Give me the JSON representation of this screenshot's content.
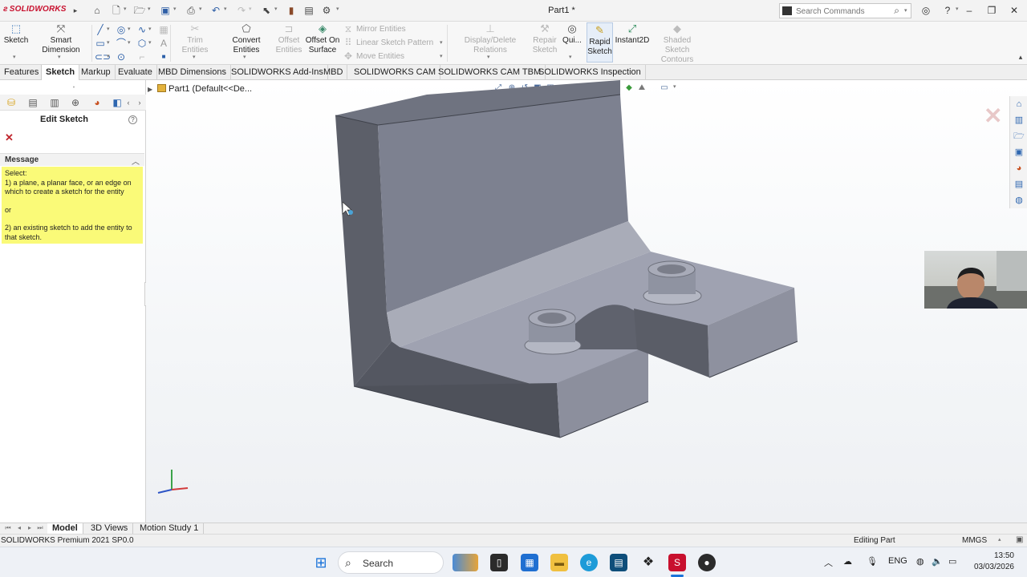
{
  "app": {
    "logo_text": "SOLIDWORKS",
    "document_title": "Part1 *",
    "brand_color": "#c8102e"
  },
  "search": {
    "placeholder": "Search Commands"
  },
  "ribbon": {
    "sketch_label": "Sketch",
    "smart_dimension_label": "Smart Dimension",
    "trim_entities_label": "Trim Entities",
    "convert_entities_label": "Convert Entities",
    "offset_entities_label_1": "Offset",
    "offset_entities_label_2": "Entities",
    "offset_on_surface_label_1": "Offset On",
    "offset_on_surface_label_2": "Surface",
    "mirror_entities_label": "Mirror Entities",
    "linear_sketch_pattern_label": "Linear Sketch Pattern",
    "move_entities_label": "Move Entities",
    "display_delete_relations_label": "Display/Delete Relations",
    "repair_sketch_label_1": "Repair",
    "repair_sketch_label_2": "Sketch",
    "quick_snaps_label": "Qui...",
    "rapid_sketch_label_1": "Rapid",
    "rapid_sketch_label_2": "Sketch",
    "instant2d_label": "Instant2D",
    "shaded_sketch_contours_label_1": "Shaded Sketch",
    "shaded_sketch_contours_label_2": "Contours"
  },
  "tabs": [
    {
      "label": "Features"
    },
    {
      "label": "Sketch"
    },
    {
      "label": "Markup"
    },
    {
      "label": "Evaluate"
    },
    {
      "label": "MBD Dimensions"
    },
    {
      "label": "SOLIDWORKS Add-Ins"
    },
    {
      "label": "MBD"
    },
    {
      "label": "SOLIDWORKS CAM"
    },
    {
      "label": "SOLIDWORKS CAM TBM"
    },
    {
      "label": "SOLIDWORKS Inspection"
    }
  ],
  "property_manager": {
    "title": "Edit Sketch",
    "message_header": "Message",
    "message_line1": "Select:",
    "message_line2": "1) a plane, a planar face, or an edge on which to create a sketch for the entity",
    "message_line3": "or",
    "message_line4": "2) an existing sketch to add the entity to that sketch."
  },
  "feature_tree": {
    "root_label": "Part1  (Default<<De..."
  },
  "bottom_tabs": [
    {
      "label": "Model"
    },
    {
      "label": "3D Views"
    },
    {
      "label": "Motion Study 1"
    }
  ],
  "status": {
    "left": "SOLIDWORKS Premium 2021 SP0.0",
    "editing": "Editing Part",
    "units": "MMGS"
  },
  "taskbar": {
    "search_label": "Search",
    "language": "ENG",
    "time": "13:50",
    "date": "03/03/2026"
  }
}
